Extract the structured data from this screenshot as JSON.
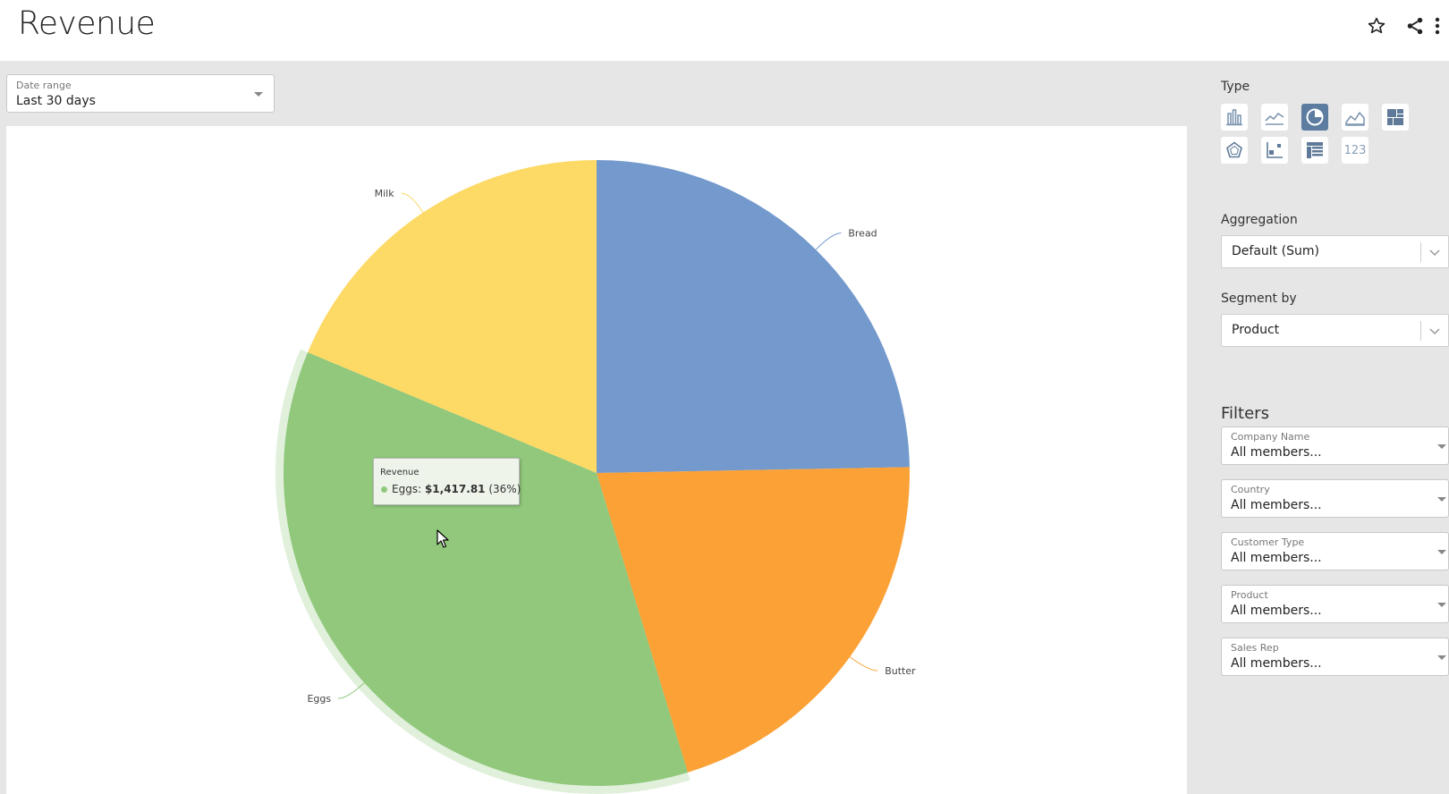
{
  "header": {
    "title": "Revenue",
    "icons": [
      "star-icon",
      "share-icon",
      "more-vert-icon"
    ]
  },
  "date_range": {
    "caption": "Date range",
    "value": "Last 30 days"
  },
  "tooltip": {
    "title": "Revenue",
    "label": "Eggs:",
    "value": "$1,417.81",
    "percent": "(36%)"
  },
  "sidebar": {
    "type_label": "Type",
    "type_buttons": [
      {
        "icon": "bar-chart-icon",
        "active": false
      },
      {
        "icon": "line-chart-icon",
        "active": false
      },
      {
        "icon": "pie-chart-icon",
        "active": true
      },
      {
        "icon": "area-chart-icon",
        "active": false
      },
      {
        "icon": "treemap-icon",
        "active": false
      },
      {
        "icon": "radar-chart-icon",
        "active": false
      },
      {
        "icon": "scatter-chart-icon",
        "active": false
      },
      {
        "icon": "pivot-table-icon",
        "active": false
      },
      {
        "icon": "kpi-number-icon",
        "active": false,
        "text": "123"
      }
    ],
    "aggregation_label": "Aggregation",
    "aggregation_value": "Default (Sum)",
    "segment_label": "Segment by",
    "segment_value": "Product",
    "filters_title": "Filters",
    "filters": [
      {
        "caption": "Company Name",
        "value": "All members..."
      },
      {
        "caption": "Country",
        "value": "All members..."
      },
      {
        "caption": "Customer Type",
        "value": "All members..."
      },
      {
        "caption": "Product",
        "value": "All members..."
      },
      {
        "caption": "Sales Rep",
        "value": "All members..."
      }
    ]
  },
  "colors": {
    "bread": "#7399cd",
    "butter": "#fba136",
    "eggs": "#91c87c",
    "milk": "#fdd966",
    "active_type": "#5c7ca0"
  },
  "chart_data": {
    "type": "pie",
    "categories": [
      "Bread",
      "Butter",
      "Eggs",
      "Milk"
    ],
    "values": [
      24.7,
      20.6,
      36,
      18.7
    ],
    "colors": [
      "#7399cd",
      "#fba136",
      "#91c87c",
      "#fdd966"
    ],
    "highlighted": "Eggs"
  }
}
